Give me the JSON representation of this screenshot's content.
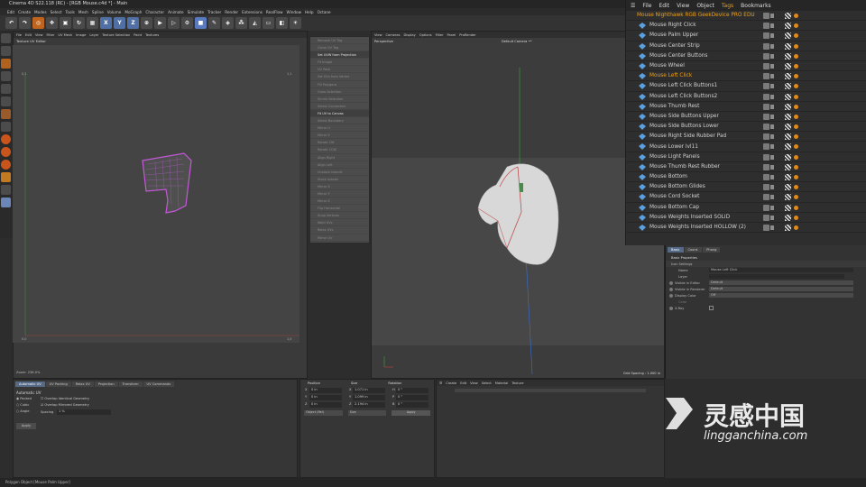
{
  "window": {
    "title": "Cinema 4D S22.118 (RC) - [RGB Mouse.c4d *] - Main"
  },
  "menubar": [
    "Edit",
    "Create",
    "Modes",
    "Select",
    "Tools",
    "Mesh",
    "Spline",
    "Volume",
    "MoGraph",
    "Character",
    "Animate",
    "Simulate",
    "Tracker",
    "Render",
    "Extensions",
    "RealFlow",
    "Window",
    "Help",
    "Octane"
  ],
  "uv_editor": {
    "menu": [
      "File",
      "Edit",
      "View",
      "Filter",
      "UV Mesh",
      "Image",
      "Layer",
      "Texture Selection",
      "Paint",
      "Textures"
    ],
    "title": "Texture UV Editor",
    "zoom": "Zoom: 236.0%",
    "tick_tl": "0,1",
    "tick_tr": "1,1",
    "tick_bl": "0,0",
    "tick_br": "1,0"
  },
  "uv_commands": [
    "Remove UV Tag",
    "Clean UV Tag",
    "Set UVW from Projection",
    "Fit Image",
    "Fit UV to Canvas",
    "UV Pack",
    "Set UVs from Vertex",
    "Fill Polygons",
    "Grow Selection",
    "Shrink Selection",
    "Select Connected",
    "Select Boundary",
    "Mirror U",
    "Mirror V",
    "Rotate CW",
    "Rotate CCW",
    "Align Right",
    "Align Left",
    "Unstack Islands",
    "Stack Islands",
    "Mirror X",
    "Mirror Y",
    "Mirror Z",
    "Flip Horizontal",
    "Snap Vertices",
    "Weld UVs",
    "Relax UVs",
    "Mirror UV",
    "Remove"
  ],
  "viewport": {
    "menu": [
      "View",
      "Cameras",
      "Display",
      "Options",
      "Filter",
      "Panel",
      "ProRender"
    ],
    "name": "Perspective",
    "camera": "Default Camera •*",
    "grid": "Grid Spacing : 1.000 in"
  },
  "object_manager": {
    "menu": [
      "File",
      "Edit",
      "View",
      "Object",
      "Tags",
      "Bookmarks"
    ],
    "root": "Mouse Nighthawk RGB GeekDevice PRO EDU",
    "items": [
      "Mouse Right Click",
      "Mouse Palm Upper",
      "Mouse Center Strip",
      "Mouse Center Buttons",
      "Mouse Wheel",
      "Mouse Left Click",
      "Mouse Left Click Buttons1",
      "Mouse Left Click Buttons2",
      "Mouse Thumb Rest",
      "Mouse Side Buttons Upper",
      "Mouse Side Buttons Lower",
      "Mouse Right Side Rubber Pad",
      "Mouse Lower lvl11",
      "Mouse Light Panels",
      "Mouse Thumb Rest Rubber",
      "Mouse Bottom",
      "Mouse Bottom Glides",
      "Mouse Cord Socket",
      "Mouse Bottom Cap",
      "Mouse Weights Inserted SOLID",
      "Mouse Weights Inserted HOLLOW (2)"
    ],
    "selected": "Mouse Left Click"
  },
  "attributes": {
    "tabs": [
      "Basic",
      "Coord.",
      "Phong"
    ],
    "section": "Basic Properties",
    "subsection": "Icon Settings",
    "fields": [
      {
        "label": "Name",
        "value": "Mouse Left Click"
      },
      {
        "label": "Layer",
        "value": ""
      },
      {
        "label": "Visible in Editor",
        "value": "Default"
      },
      {
        "label": "Visible in Renderer",
        "value": "Default"
      },
      {
        "label": "Display Color",
        "value": "Off"
      },
      {
        "label": "Color",
        "value": ""
      },
      {
        "label": "X-Ray",
        "value": ""
      }
    ]
  },
  "uv_tools": {
    "tabs": [
      "Automatic UV",
      "UV Packing",
      "Relax UV",
      "Projection",
      "Transform",
      "UV Commands"
    ],
    "heading": "Automatic UV",
    "options": [
      "Packed",
      "Cubic",
      "Angle"
    ],
    "checks": [
      "Overlap Identical Geometry",
      "Overlap Mirrored Geometry"
    ],
    "spacing_label": "Spacing",
    "spacing_value": "1 %",
    "apply": "Apply"
  },
  "coordinates": {
    "headers": [
      "Position",
      "Size",
      "Rotation"
    ],
    "rows": [
      {
        "axis": "X",
        "pos": "0 in",
        "size": "1.071 in",
        "rlabel": "H",
        "rot": "0 °"
      },
      {
        "axis": "Y",
        "pos": "0 in",
        "size": "1.099 in",
        "rlabel": "P",
        "rot": "0 °"
      },
      {
        "axis": "Z",
        "pos": "0 in",
        "size": "2.194 in",
        "rlabel": "B",
        "rot": "0 °"
      }
    ],
    "mode": "Object (Rel)",
    "size_mode": "Size",
    "apply": "Apply"
  },
  "material_manager": {
    "menu": [
      "Create",
      "Edit",
      "View",
      "Select",
      "Material",
      "Texture"
    ]
  },
  "status": "Polygon Object [Mouse Palm Upper]",
  "watermark": {
    "cn": "灵感中国",
    "url": "lingganchina.com"
  }
}
